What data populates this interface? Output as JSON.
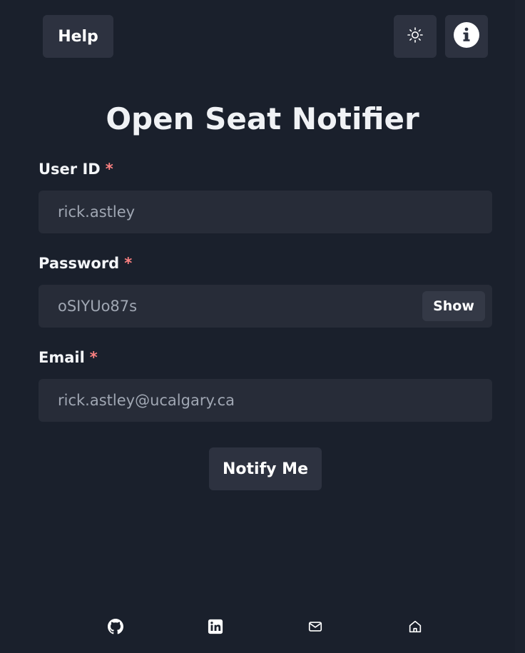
{
  "header": {
    "help_label": "Help",
    "theme_icon": "sun-icon",
    "info_icon": "info-icon"
  },
  "title": "Open Seat Notifier",
  "form": {
    "user_id": {
      "label": "User ID",
      "required_mark": "*",
      "value": "rick.astley"
    },
    "password": {
      "label": "Password",
      "required_mark": "*",
      "value": "oSIYUo87s",
      "toggle_label": "Show"
    },
    "email": {
      "label": "Email",
      "required_mark": "*",
      "value": "rick.astley@ucalgary.ca"
    },
    "submit_label": "Notify Me"
  },
  "footer": {
    "links": [
      "github-icon",
      "linkedin-icon",
      "mail-icon",
      "home-icon"
    ]
  },
  "colors": {
    "background": "#1a202c",
    "button": "#2d3240",
    "input": "#272c38",
    "required": "#fc8181"
  }
}
